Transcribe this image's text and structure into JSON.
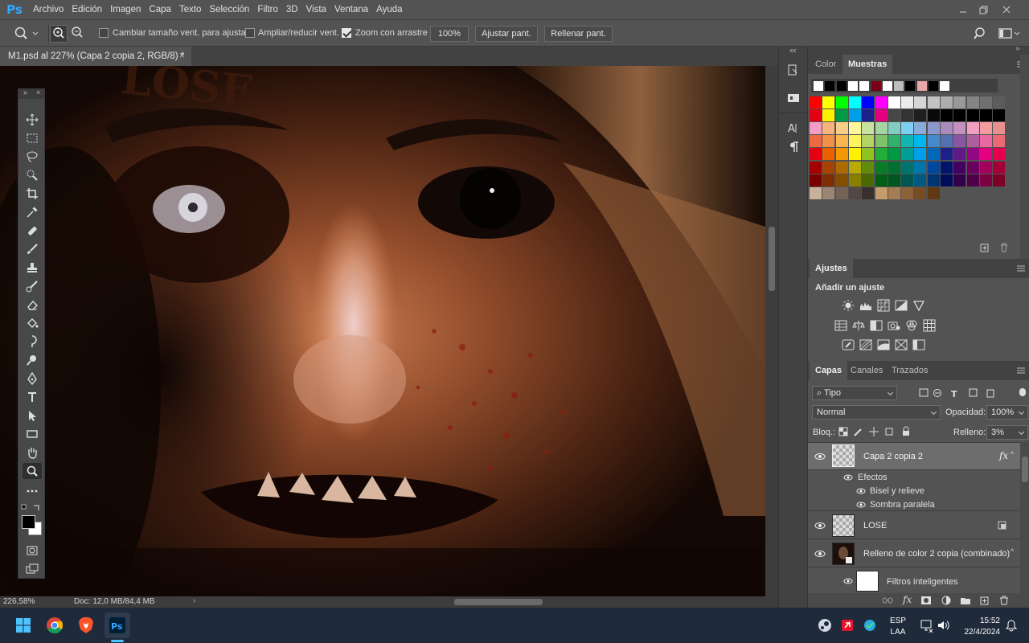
{
  "app": {
    "logo": "Ps"
  },
  "menu": [
    "Archivo",
    "Edición",
    "Imagen",
    "Capa",
    "Texto",
    "Selección",
    "Filtro",
    "3D",
    "Vista",
    "Ventana",
    "Ayuda"
  ],
  "options": {
    "resize_windows_label": "Cambiar tamaño vent. para ajustar",
    "resize_windows_checked": false,
    "zoom_all_label": "Ampliar/reducir vent.",
    "zoom_all_checked": false,
    "scrubby_zoom_label": "Zoom con arrastre",
    "scrubby_zoom_checked": true,
    "zoom_100_label": "100%",
    "fit_screen_label": "Ajustar pant.",
    "fill_screen_label": "Rellenar pant."
  },
  "document": {
    "tab_title": "M1.psd al 227% (Capa 2 copia 2, RGB/8) *",
    "canvas_text": "LOSE",
    "zoom_status": "226,58%",
    "doc_size": "Doc: 12,0 MB/84,4 MB"
  },
  "swatches_panel": {
    "tabs": [
      "Color",
      "Muestras"
    ],
    "active_tab": "Muestras",
    "recent": [
      "#ffffff",
      "#000000",
      "#000000",
      "#ffffff",
      "#ffffff",
      "#7a0018",
      "#ffffff",
      "#bdbdbd",
      "#000000",
      "#e8a8a8",
      "#000000",
      "#ffffff"
    ],
    "rows": [
      [
        "#ff0000",
        "#ffff00",
        "#00ff00",
        "#00ffff",
        "#0000ff",
        "#ff00ff",
        "#ffffff",
        "#ebebeb",
        "#d6d6d6",
        "#c2c2c2",
        "#adadad",
        "#999999",
        "#858585",
        "#707070",
        "#5c5c5c"
      ],
      [
        "#e60012",
        "#fff100",
        "#009944",
        "#00a0e9",
        "#1d2088",
        "#e4007f",
        "#474747",
        "#333333",
        "#1f1f1f",
        "#0a0a0a",
        "#000000",
        "#000000",
        "#000000",
        "#000000",
        "#000000"
      ],
      [
        "#f19ec2",
        "#f6b37f",
        "#facd89",
        "#fff799",
        "#c8e29f",
        "#a6d4a3",
        "#80cdc1",
        "#7ecef4",
        "#88abda",
        "#8c97cb",
        "#aa89bd",
        "#c490bf",
        "#f19ec2",
        "#f29c9f",
        "#ea8f8f"
      ],
      [
        "#ec6941",
        "#f19149",
        "#f8b551",
        "#fff45c",
        "#b3d465",
        "#80c269",
        "#32b16c",
        "#13b5b1",
        "#00b7ee",
        "#448aca",
        "#556fb5",
        "#8957a1",
        "#ae5da1",
        "#ea68a2",
        "#eb6877"
      ],
      [
        "#e60012",
        "#eb6100",
        "#f39800",
        "#fff100",
        "#8fc31f",
        "#22ac38",
        "#009944",
        "#009e96",
        "#00a0e9",
        "#0068b7",
        "#1d2088",
        "#601986",
        "#920783",
        "#e4007f",
        "#e5004f"
      ],
      [
        "#a40000",
        "#a84200",
        "#ac6a00",
        "#b7aa00",
        "#638c0b",
        "#097c25",
        "#007130",
        "#00736d",
        "#0075a9",
        "#00479d",
        "#00146e",
        "#440062",
        "#6a005f",
        "#a4005b",
        "#a40035"
      ],
      [
        "#7d0000",
        "#7f2d00",
        "#834e00",
        "#8a8000",
        "#4a6a00",
        "#005e15",
        "#005620",
        "#005752",
        "#005982",
        "#003471",
        "#000b59",
        "#32004b",
        "#4f0048",
        "#7d0043",
        "#7d0026"
      ],
      [
        "#c7b299",
        "#998675",
        "#736357",
        "#534741",
        "#37302d",
        "#c69c6d",
        "#a67c52",
        "#8c6239",
        "#754c24",
        "#603913"
      ]
    ]
  },
  "adjustments_panel": {
    "tab": "Ajustes",
    "heading": "Añadir un ajuste"
  },
  "layers_panel": {
    "tabs": [
      "Capas",
      "Canales",
      "Trazados"
    ],
    "active_tab": "Capas",
    "filter_kind": "Tipo",
    "blend_mode": "Normal",
    "opacity_label": "Opacidad:",
    "opacity_value": "100%",
    "lock_label": "Bloq.:",
    "fill_label": "Relleno:",
    "fill_value": "3%",
    "layers": [
      {
        "name": "Capa 2 copia 2",
        "fx": "fx",
        "selected": true
      },
      {
        "name": "Efectos"
      },
      {
        "name": "Bisel y relieve"
      },
      {
        "name": "Sombra paralela"
      },
      {
        "name": "LOSE"
      },
      {
        "name": "Relleno de color 2 copia (combinado)"
      },
      {
        "name": "Filtros inteligentes"
      }
    ]
  },
  "taskbar": {
    "lang_top": "ESP",
    "lang_bottom": "LAA",
    "time": "15:52",
    "date": "22/4/2024"
  },
  "colors": {
    "ui_bg": "#535353",
    "panel_dark": "#424242",
    "ps_blue": "#31a8ff",
    "taskbar": "#1f2a3a"
  }
}
